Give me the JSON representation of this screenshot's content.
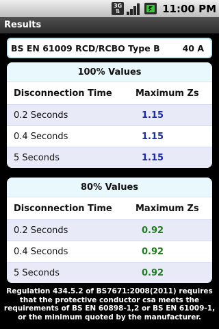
{
  "status_bar": {
    "network_label": "3G",
    "time": "11:00 PM",
    "icons": [
      "network-3g-icon",
      "signal-strength-icon",
      "battery-icon"
    ]
  },
  "app": {
    "title": "Results"
  },
  "summary": {
    "device": "BS EN 61009 RCD/RCBO Type B",
    "rating": "40 A"
  },
  "tables": [
    {
      "title": "100% Values",
      "col_left": "Disconnection Time",
      "col_right": "Maximum Zs",
      "value_color": "#1a2aa8",
      "rows": [
        {
          "time": "0.2 Seconds",
          "zs": "1.15"
        },
        {
          "time": "0.4 Seconds",
          "zs": "1.15"
        },
        {
          "time": "5 Seconds",
          "zs": "1.15"
        }
      ]
    },
    {
      "title": "80% Values",
      "col_left": "Disconnection Time",
      "col_right": "Maximum Zs",
      "value_color": "#1f7d1f",
      "rows": [
        {
          "time": "0.2 Seconds",
          "zs": "0.92"
        },
        {
          "time": "0.4 Seconds",
          "zs": "0.92"
        },
        {
          "time": "5 Seconds",
          "zs": "0.92"
        }
      ]
    }
  ],
  "footer": {
    "text": "Regulation 434.5.2 of BS7671:2008(2011) requires that the protective conductor csa meets the requirements of BS EN 60898-1,2 or BS EN 61009-1, or the minimum quoted by the manufacturer."
  }
}
